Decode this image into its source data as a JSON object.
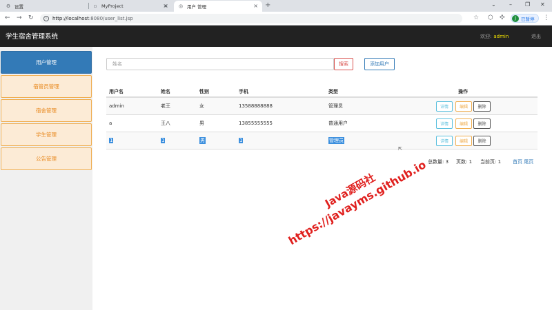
{
  "browser": {
    "tabs": [
      {
        "title": "设置",
        "icon": "gear-icon"
      },
      {
        "title": "MyProject",
        "icon": "page-icon"
      },
      {
        "title": "用户 管理",
        "icon": "globe-icon",
        "active": true
      }
    ],
    "new_tab_glyph": "+",
    "url_host": "http://localhost",
    "url_path": ":8080/user_list.jsp",
    "profile_initial": "J",
    "profile_status": "已暂停"
  },
  "app": {
    "title": "学生宿舍管理系统",
    "welcome_label": "欢迎:",
    "username": "admin",
    "logout_label": "退出"
  },
  "sidebar": {
    "items": [
      {
        "label": "用户管理",
        "active": true
      },
      {
        "label": "宿管员管理"
      },
      {
        "label": "宿舍管理"
      },
      {
        "label": "学生管理"
      },
      {
        "label": "公告管理"
      }
    ]
  },
  "search": {
    "placeholder": "姓名",
    "search_label": "搜索",
    "add_label": "添加用户"
  },
  "table": {
    "headers": [
      "用户名",
      "姓名",
      "性别",
      "手机",
      "类型",
      "操作"
    ],
    "rows": [
      [
        "admin",
        "老王",
        "女",
        "13588888888",
        "管理员"
      ],
      [
        "a",
        "王八",
        "男",
        "13855555555",
        "普通用户"
      ],
      [
        "1",
        "1",
        "男",
        "1",
        "管理员"
      ]
    ],
    "actions": {
      "detail": "详情",
      "edit": "编辑",
      "delete": "删除"
    }
  },
  "pager": {
    "total_label": "总数量:",
    "total": "3",
    "pages_label": "页数:",
    "pages": "1",
    "current_label": "当前页:",
    "current": "1",
    "first_label": "首页",
    "last_label": "尾页"
  },
  "watermark": {
    "line1": "Java源码社",
    "line2": "https://javayms.github.io"
  }
}
